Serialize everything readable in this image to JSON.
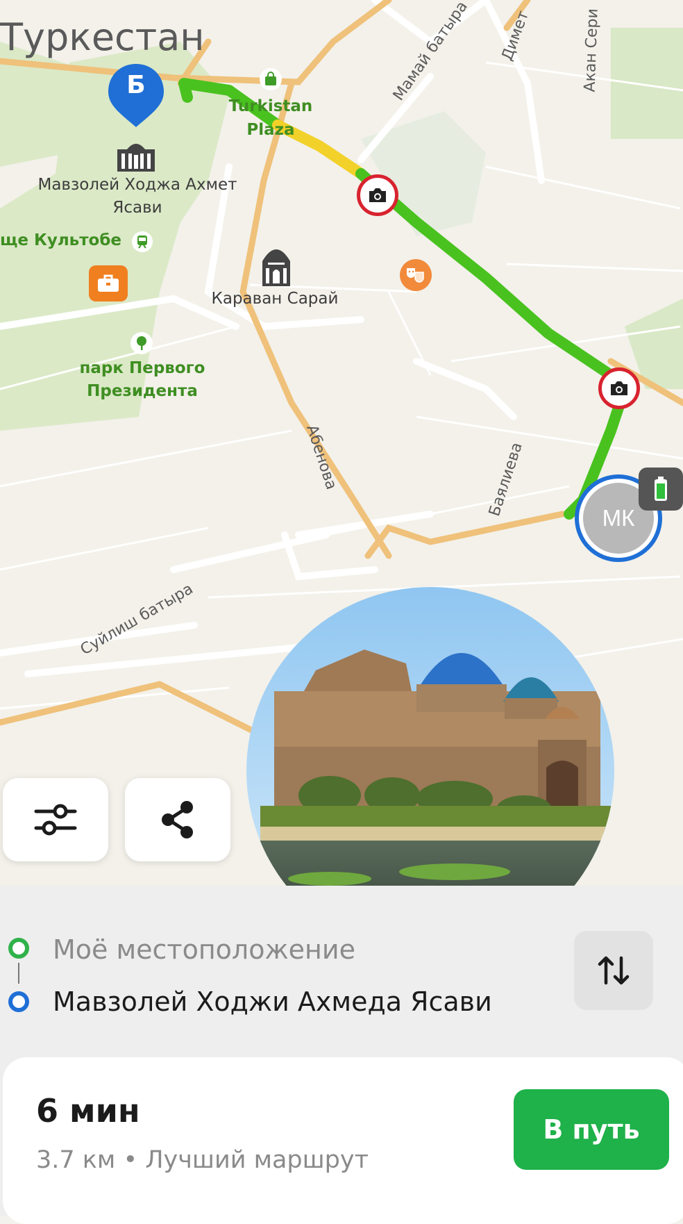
{
  "map": {
    "city_label": "Туркестан",
    "destination_pin_letter": "Б",
    "pois": {
      "mausoleum": "Мавзолей Ходжа Ахмет Ясави",
      "plaza": "Turkistan Plaza",
      "kultobe": "ще Культобе",
      "caravan": "Караван Сарай",
      "park": "парк Первого Президента"
    },
    "streets": {
      "mamai": "Мамай батыра",
      "dimet": "Димет",
      "akan": "Акан Сери",
      "abenova": "Абенова",
      "bayalieva": "Баялиева",
      "suilish": "Суйлиш батыра"
    },
    "user_avatar_initials": "МК",
    "battery_status": "charging"
  },
  "map_controls": {
    "settings_icon": "sliders-icon",
    "share_icon": "share-icon"
  },
  "route": {
    "from": "Моё местоположение",
    "to": "Мавзолей Ходжи Ахмеда Ясави",
    "swap_icon": "swap-vertical-icon"
  },
  "summary": {
    "eta": "6 мин",
    "details": "3.7 км • Лучший маршрут",
    "go_button": "В путь"
  },
  "colors": {
    "route_green": "#49c21f",
    "route_yellow": "#f2d12a",
    "accent_blue": "#1f6fd6",
    "go_green": "#1fb14a",
    "camera_red": "#d8232f"
  }
}
